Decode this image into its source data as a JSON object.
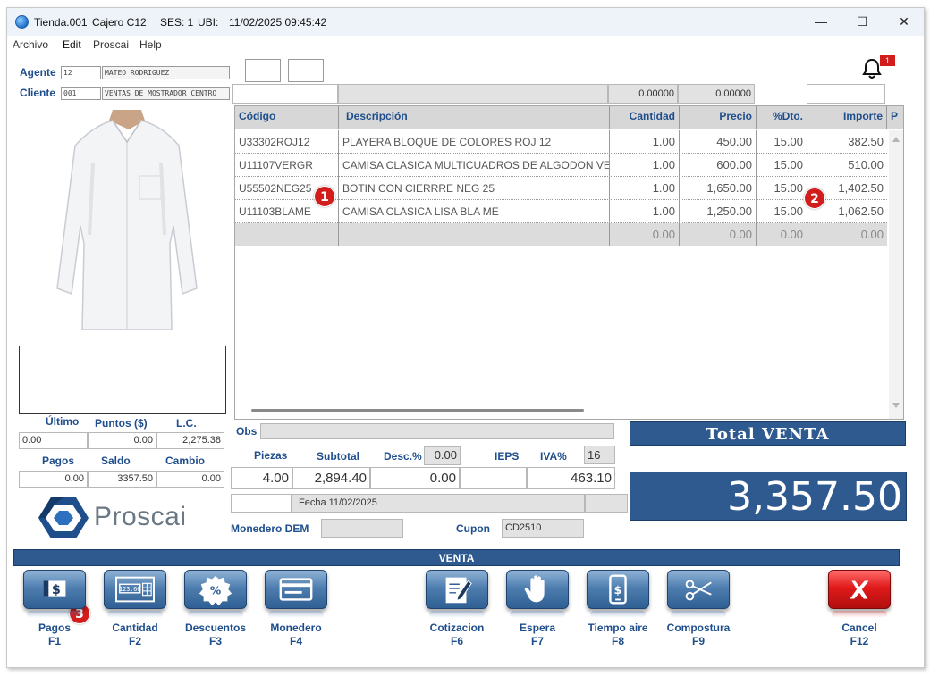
{
  "titlebar": {
    "store": "Tienda.001",
    "cashier": "Cajero C12",
    "session": "SES: 1",
    "location": "UBI:",
    "datetime": "11/02/2025 09:45:42",
    "minimize": "—",
    "maximize": "☐",
    "close": "✕"
  },
  "menu": {
    "archivo": "Archivo",
    "edit": "Edit",
    "proscai": "Proscai",
    "help": "Help"
  },
  "customer": {
    "agent_label": "Agente",
    "agent_code": "12",
    "agent_name": "MATEO RODRIGUEZ",
    "client_label": "Cliente",
    "client_code": "001",
    "client_name": "VENTAS DE MOSTRADOR CENTRO"
  },
  "header_fields": {
    "val1": "0.00000",
    "val2": "0.00000"
  },
  "grid": {
    "columns": [
      "Código",
      "Descripción",
      "Cantidad",
      "Precio",
      "%Dto.",
      "Importe",
      "P"
    ],
    "rows": [
      {
        "code": "U33302ROJ12",
        "desc": "PLAYERA BLOQUE DE COLORES ROJ 12",
        "qty": "1.00",
        "price": "450.00",
        "disc": "15.00",
        "amount": "382.50"
      },
      {
        "code": "U11107VERGR",
        "desc": "CAMISA CLASICA MULTICUADROS DE ALGODON VE",
        "qty": "1.00",
        "price": "600.00",
        "disc": "15.00",
        "amount": "510.00"
      },
      {
        "code": "U55502NEG25",
        "desc": "BOTIN  CON CIERRRE NEG 25",
        "qty": "1.00",
        "price": "1,650.00",
        "disc": "15.00",
        "amount": "1,402.50"
      },
      {
        "code": "U11103BLAME",
        "desc": "CAMISA CLASICA LISA BLA ME",
        "qty": "1.00",
        "price": "1,250.00",
        "disc": "15.00",
        "amount": "1,062.50"
      }
    ],
    "empty_row": {
      "qty": "0.00",
      "price": "0.00",
      "disc": "0.00",
      "amount": "0.00"
    }
  },
  "markers": [
    "1",
    "2",
    "3"
  ],
  "notification_count": "1",
  "balances": {
    "ultimo_label": "Último",
    "puntos_label": "Puntos ($)",
    "lc_label": "L.C.",
    "ultimo": "0.00",
    "puntos": "0.00",
    "lc": "2,275.38",
    "pagos_label": "Pagos",
    "saldo_label": "Saldo",
    "cambio_label": "Cambio",
    "pagos": "0.00",
    "saldo": "3357.50",
    "cambio": "0.00"
  },
  "brand": "Proscai",
  "summary": {
    "obs_label": "Obs",
    "piezas_label": "Piezas",
    "subtotal_label": "Subtotal",
    "desc_label": "Desc.%",
    "desc_pct": "0.00",
    "ieps_label": "IEPS",
    "iva_label": "IVA%",
    "iva_pct": "16",
    "piezas": "4.00",
    "subtotal": "2,894.40",
    "descuento": "0.00",
    "iva": "463.10",
    "fecha": "Fecha 11/02/2025",
    "monedero_label": "Monedero DEM",
    "cupon_label": "Cupon",
    "cupon": "CD2510"
  },
  "total": {
    "title": "Total VENTA",
    "value": "3,357.50"
  },
  "venta_bar": "VENTA",
  "buttons": [
    {
      "label": "Pagos",
      "key": "F1",
      "icon": "cash-icon"
    },
    {
      "label": "Cantidad",
      "key": "F2",
      "icon": "calculator-icon"
    },
    {
      "label": "Descuentos",
      "key": "F3",
      "icon": "percent-icon"
    },
    {
      "label": "Monedero",
      "key": "F4",
      "icon": "wallet-card-icon"
    },
    {
      "label": "Cotizacion",
      "key": "F6",
      "icon": "quote-edit-icon"
    },
    {
      "label": "Espera",
      "key": "F7",
      "icon": "hand-stop-icon"
    },
    {
      "label": "Tiempo aire",
      "key": "F8",
      "icon": "phone-topup-icon"
    },
    {
      "label": "Compostura",
      "key": "F9",
      "icon": "scissors-icon"
    },
    {
      "label": "Cancel",
      "key": "F12",
      "icon": "cancel-x-icon"
    }
  ],
  "colors": {
    "accent": "#2f5a8f",
    "label_blue": "#1f4e8c",
    "marker_red": "#d31c1c",
    "cancel_red": "#e01a1a"
  }
}
